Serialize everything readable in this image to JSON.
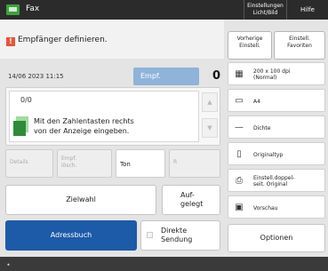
{
  "topbar": {
    "app_icon": "fax-icon",
    "app_title": "Fax",
    "settings_line1": "Einstellungen",
    "settings_line2": "Licht/Bild",
    "help": "Hilfe"
  },
  "header": {
    "warning_icon": "alert-icon",
    "title": "Empfänger definieren.",
    "prev_settings": [
      "Vorherige",
      "Einstell."
    ],
    "favorites": [
      "Einstell.",
      "Favoriten"
    ]
  },
  "status": {
    "datetime": "14/06 2023 11:15",
    "recipients_label": "Empf.",
    "recipients_count": "0"
  },
  "entry_panel": {
    "counter": "0/0",
    "hint_line1": "Mit den Zahlentasten rechts",
    "hint_line2": "von der Anzeige eingeben.",
    "scroll_up": "▲",
    "scroll_down": "▼"
  },
  "actions": {
    "details": "Details",
    "delete": [
      "Empf.",
      "lösch."
    ],
    "tone": "Ton",
    "r": "R"
  },
  "buttons": {
    "zielwahl": "Zielwahl",
    "aufgelegt": [
      "Auf-",
      "gelegt"
    ],
    "adressbuch": "Adressbuch",
    "direkt": [
      "Direkte",
      "Sendung"
    ],
    "optionen": "Optionen"
  },
  "side_menu": [
    {
      "icon": "resolution-icon",
      "glyph": "▦",
      "lines": [
        "200 x 100 dpi",
        "(Normal)"
      ]
    },
    {
      "icon": "paper-size-icon",
      "glyph": "▭",
      "lines": [
        "A4",
        ""
      ]
    },
    {
      "icon": "density-icon",
      "glyph": "—",
      "lines": [
        "Dichte",
        ""
      ]
    },
    {
      "icon": "original-type-icon",
      "glyph": "▯",
      "lines": [
        "Originaltyp",
        ""
      ]
    },
    {
      "icon": "duplex-original-icon",
      "glyph": "⎙",
      "lines": [
        "Einstell.doppel-",
        "seit. Original"
      ]
    },
    {
      "icon": "preview-icon",
      "glyph": "▣",
      "lines": [
        "Vorschau",
        ""
      ]
    }
  ],
  "colors": {
    "accent_blue": "#1d5aa8",
    "recipient_blue": "#8fb3d9",
    "warning_red": "#e8543a",
    "fax_green": "#2e8b3a"
  }
}
